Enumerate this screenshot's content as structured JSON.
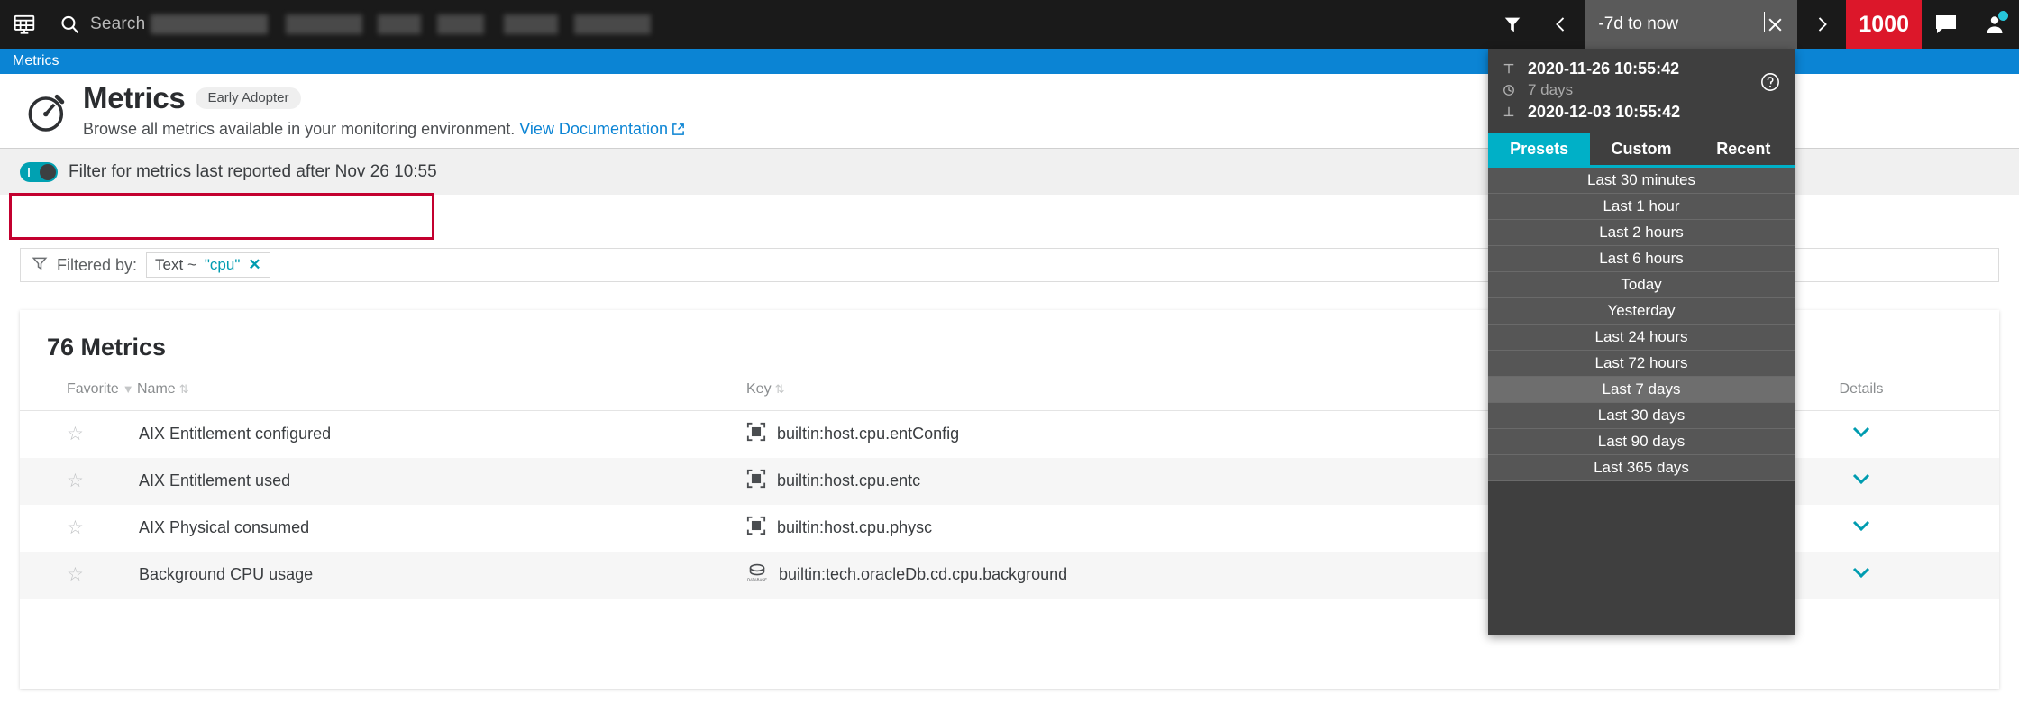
{
  "topbar": {
    "dashboard_icon": "dashboard-icon",
    "search_placeholder": "Search",
    "search_value": "",
    "filter_icon": "filter-icon",
    "prev_icon": "chevron-left-icon",
    "next_icon": "chevron-right-icon",
    "timeframe_value": "-7d to now",
    "clear_icon": "close-icon",
    "problems_count": "1000",
    "chat_icon": "chat-icon",
    "user_icon": "user-icon"
  },
  "breadcrumb": {
    "label": "Metrics"
  },
  "page": {
    "title": "Metrics",
    "badge": "Early Adopter",
    "subtitle": "Browse all metrics available in your monitoring environment.",
    "doc_link": "View Documentation",
    "icon": "stopwatch-icon"
  },
  "toggle": {
    "state": "on",
    "label": "Filter for metrics last reported after Nov 26 10:55"
  },
  "filterbar": {
    "icon": "filter-icon",
    "label": "Filtered by:",
    "chip_field": "Text ~",
    "chip_value": "\"cpu\"",
    "chip_clear": "✕"
  },
  "metrics_card": {
    "title": "76 Metrics",
    "columns": {
      "favorite": "Favorite",
      "favorite_sort": "▼",
      "name": "Name",
      "name_sort": "⇅",
      "key": "Key",
      "key_sort": "⇅",
      "details": "Details"
    },
    "rows": [
      {
        "favorite": "☆",
        "name": "AIX Entitlement configured",
        "key_icon": "host-icon",
        "key": "builtin:host.cpu.entConfig",
        "details_icon": "chevron-down-icon"
      },
      {
        "favorite": "☆",
        "name": "AIX Entitlement used",
        "key_icon": "host-icon",
        "key": "builtin:host.cpu.entc",
        "details_icon": "chevron-down-icon"
      },
      {
        "favorite": "☆",
        "name": "AIX Physical consumed",
        "key_icon": "host-icon",
        "key": "builtin:host.cpu.physc",
        "details_icon": "chevron-down-icon"
      },
      {
        "favorite": "☆",
        "name": "Background CPU usage",
        "key_icon": "database-icon",
        "key": "builtin:tech.oracleDb.cd.cpu.background",
        "details_icon": "chevron-down-icon"
      }
    ]
  },
  "timeframe_dropdown": {
    "from_label": "from-icon",
    "from": "2020-11-26 10:55:42",
    "duration_label": "clock-icon",
    "duration": "7 days",
    "to_label": "to-icon",
    "to": "2020-12-03 10:55:42",
    "help_icon": "help-icon",
    "tabs": [
      {
        "label": "Presets",
        "state": "active"
      },
      {
        "label": "Custom",
        "state": "inactive"
      },
      {
        "label": "Recent",
        "state": "inactive"
      }
    ],
    "presets": [
      {
        "label": "Last 30 minutes",
        "selected": false
      },
      {
        "label": "Last 1 hour",
        "selected": false
      },
      {
        "label": "Last 2 hours",
        "selected": false
      },
      {
        "label": "Last 6 hours",
        "selected": false
      },
      {
        "label": "Today",
        "selected": false
      },
      {
        "label": "Yesterday",
        "selected": false
      },
      {
        "label": "Last 24 hours",
        "selected": false
      },
      {
        "label": "Last 72 hours",
        "selected": false
      },
      {
        "label": "Last 7 days",
        "selected": true
      },
      {
        "label": "Last 30 days",
        "selected": false
      },
      {
        "label": "Last 90 days",
        "selected": false
      },
      {
        "label": "Last 365 days",
        "selected": false
      }
    ]
  },
  "colors": {
    "topbar_bg": "#1a1a1a",
    "breadcrumb_blue": "#0b84d4",
    "accent_cyan": "#009cb0",
    "alert_red": "#dc172a",
    "annotation_red": "#c3002f",
    "dropdown_bg": "#3f3f3f",
    "dropdown_list_bg": "#565656"
  }
}
